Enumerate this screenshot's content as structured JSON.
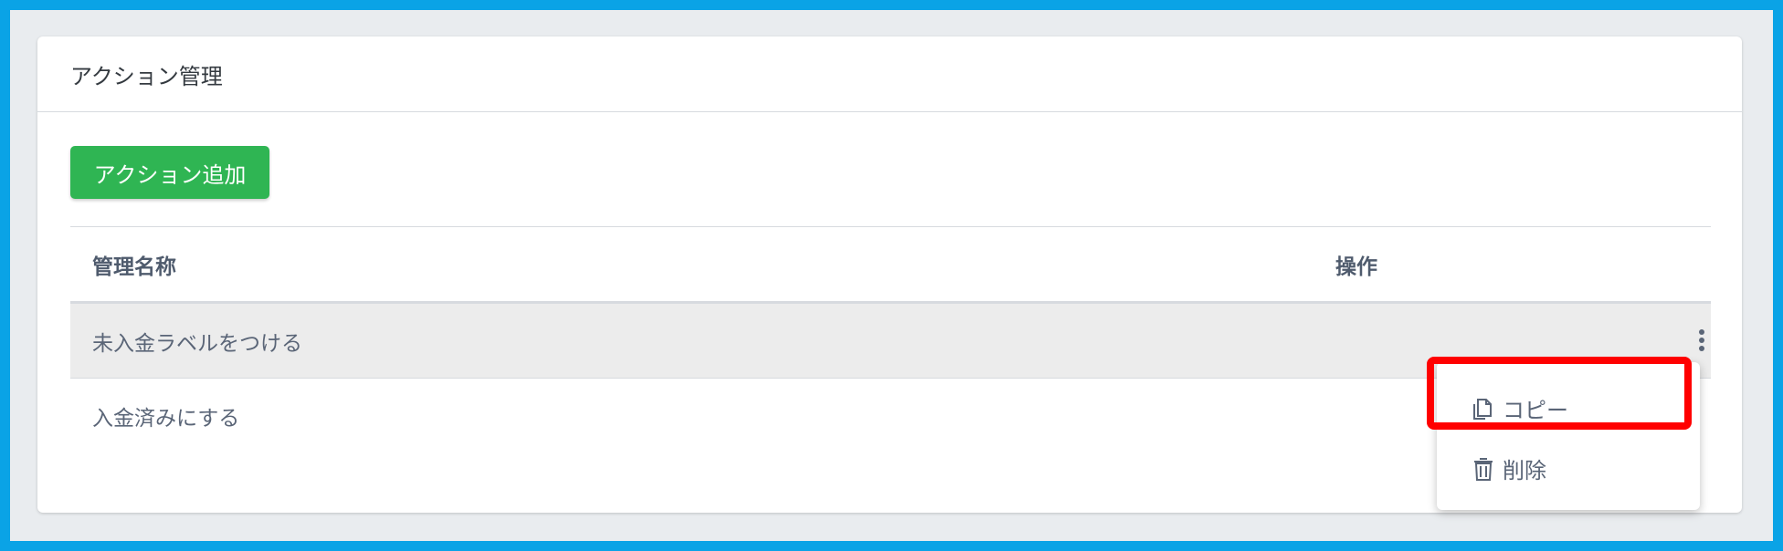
{
  "card": {
    "title": "アクション管理",
    "add_button_label": "アクション追加"
  },
  "table": {
    "headers": {
      "name": "管理名称",
      "ops": "操作"
    },
    "rows": [
      {
        "name": "未入金ラベルをつける"
      },
      {
        "name": "入金済みにする"
      }
    ]
  },
  "menu": {
    "copy_label": "コピー",
    "delete_label": "削除"
  },
  "colors": {
    "primary_button": "#2fb553",
    "highlight": "#ff0000",
    "outer_border": "#0aa3e6"
  }
}
